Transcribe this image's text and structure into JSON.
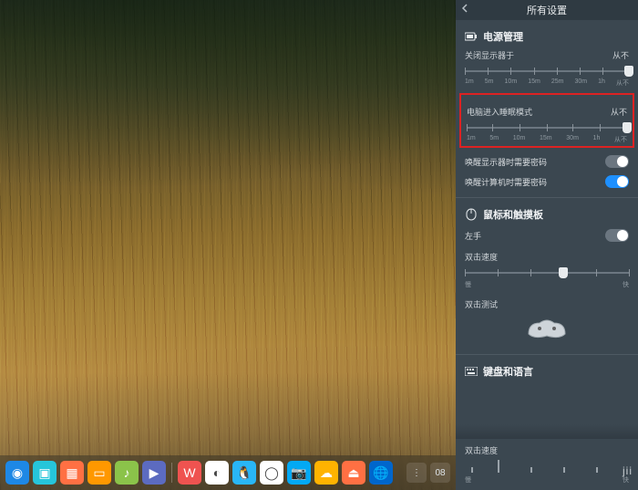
{
  "panel": {
    "title": "所有设置",
    "power": {
      "section": "电源管理",
      "display_off": {
        "label": "关闭显示器于",
        "value": "从不"
      },
      "sleep": {
        "label": "电脑进入睡眠模式",
        "value": "从不"
      },
      "ticks": [
        "1m",
        "5m",
        "10m",
        "15m",
        "25m",
        "30m",
        "1h",
        "从不"
      ],
      "ticks2": [
        "1m",
        "5m",
        "10m",
        "15m",
        "30m",
        "1h",
        "从不"
      ],
      "wake_display_pw": "唤醒显示器时需要密码",
      "wake_computer_pw": "唤醒计算机时需要密码",
      "wake_display_pw_on": false,
      "wake_computer_pw_on": true
    },
    "mouse": {
      "section": "鼠标和触摸板",
      "left_hand": "左手",
      "left_hand_on": false,
      "dblclick_speed": "双击速度",
      "slow": "慢",
      "fast": "快",
      "dblclick_test": "双击测试"
    },
    "keyboard": {
      "section": "键盘和语言",
      "repeat_speed": "双击速度",
      "slow": "慢",
      "fast": "快",
      "jii": "jii"
    }
  },
  "dock": {
    "items": [
      {
        "name": "launcher",
        "bg": "#1e88e5",
        "glyph": "◉"
      },
      {
        "name": "files",
        "bg": "#26c6da",
        "glyph": "▣"
      },
      {
        "name": "app-store",
        "bg": "#ff7043",
        "glyph": "▦"
      },
      {
        "name": "calendar",
        "bg": "#ff9800",
        "glyph": "▭"
      },
      {
        "name": "music",
        "bg": "#8bc34a",
        "glyph": "♪"
      },
      {
        "name": "video",
        "bg": "#5c6bc0",
        "glyph": "▶"
      },
      {
        "name": "sep"
      },
      {
        "name": "wps",
        "bg": "#ef5350",
        "glyph": "W"
      },
      {
        "name": "chrome",
        "bg": "#ffffff",
        "glyph": "◐"
      },
      {
        "name": "qq",
        "bg": "#29b6f6",
        "glyph": "🐧"
      },
      {
        "name": "spinner",
        "bg": "#ffffff",
        "glyph": "◯"
      },
      {
        "name": "camera",
        "bg": "#03a9f4",
        "glyph": "📷"
      },
      {
        "name": "cloud",
        "bg": "#ffb300",
        "glyph": "☁"
      },
      {
        "name": "eject",
        "bg": "#ff7043",
        "glyph": "⏏"
      },
      {
        "name": "browser",
        "bg": "#0066cc",
        "glyph": "🌐"
      }
    ],
    "tray": [
      {
        "name": "tray-1",
        "glyph": "⋮"
      },
      {
        "name": "tray-time",
        "glyph": "08"
      }
    ]
  }
}
